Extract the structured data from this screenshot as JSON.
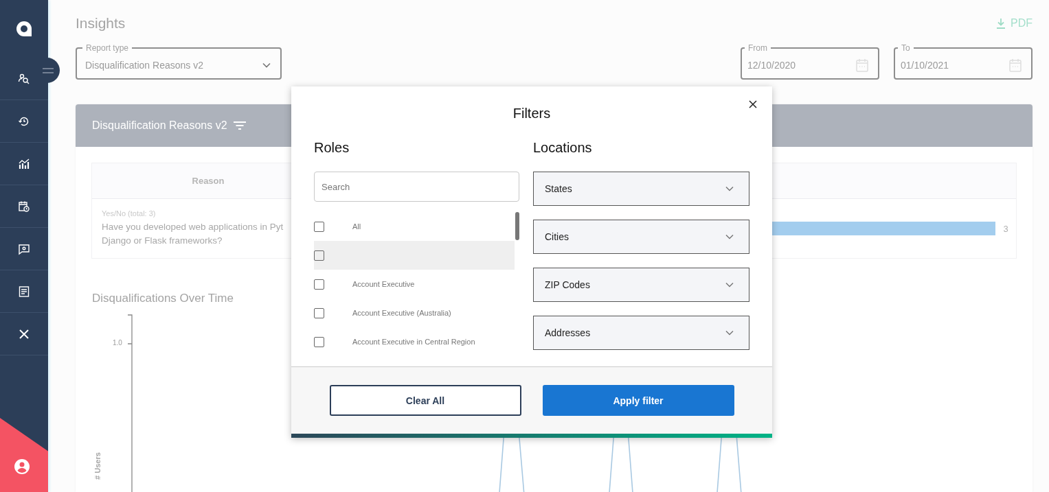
{
  "sidebar": {
    "items": [
      {
        "selected": false
      },
      {
        "selected": false
      },
      {
        "selected": false
      },
      {
        "selected": false
      },
      {
        "selected": false
      },
      {
        "selected": false
      },
      {
        "selected": false
      }
    ]
  },
  "page": {
    "title": "Insights",
    "pdf_label": "PDF"
  },
  "report_type": {
    "label": "Report type",
    "value": "Disqualification Reasons v2"
  },
  "date_from": {
    "label": "From",
    "value": "12/10/2020"
  },
  "date_to": {
    "label": "To",
    "value": "01/10/2021"
  },
  "report": {
    "title": "Disqualification Reasons v2",
    "column_1": "Reason",
    "row": {
      "meta": "Yes/No (total: 3)",
      "question_lines": [
        "Have you developed web applications in Pyt",
        "Django or Flask frameworks?"
      ],
      "count": "3"
    }
  },
  "chart": {
    "title": "Disqualifications Over Time",
    "ylabel": "# Users",
    "ytick": "1.0"
  },
  "filters": {
    "title": "Filters",
    "roles_title": "Roles",
    "search": {
      "placeholder": "Search"
    },
    "roles": [
      {
        "label": "All",
        "checked": false,
        "hovered": false
      },
      {
        "checked": false,
        "hovered": true
      },
      {
        "label": "Account Executive",
        "checked": false,
        "hovered": false
      },
      {
        "label": "Account Executive (Australia)",
        "checked": false,
        "hovered": false
      },
      {
        "label": "Account Executive in Central Region",
        "checked": false,
        "hovered": false
      }
    ],
    "locations_title": "Locations",
    "locations": [
      "States",
      "Cities",
      "ZIP Codes",
      "Addresses"
    ],
    "buttons": [
      {
        "label": "Clear All",
        "kind": "secondary"
      },
      {
        "label": "Apply filter",
        "kind": "primary"
      }
    ]
  }
}
